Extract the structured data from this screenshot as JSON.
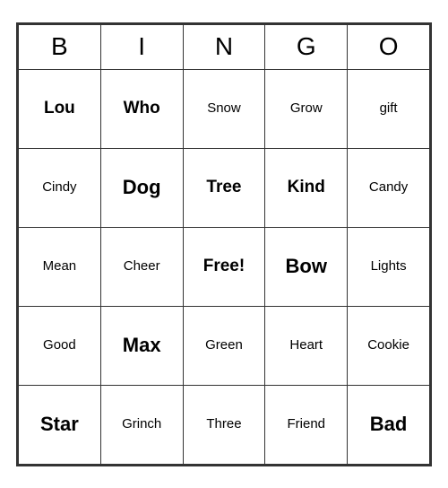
{
  "header": {
    "letters": [
      "B",
      "I",
      "N",
      "G",
      "O"
    ]
  },
  "rows": [
    [
      {
        "text": "Lou",
        "size": "medium"
      },
      {
        "text": "Who",
        "size": "medium"
      },
      {
        "text": "Snow",
        "size": "small"
      },
      {
        "text": "Grow",
        "size": "small"
      },
      {
        "text": "gift",
        "size": "small"
      }
    ],
    [
      {
        "text": "Cindy",
        "size": "small"
      },
      {
        "text": "Dog",
        "size": "large"
      },
      {
        "text": "Tree",
        "size": "medium"
      },
      {
        "text": "Kind",
        "size": "medium"
      },
      {
        "text": "Candy",
        "size": "small"
      }
    ],
    [
      {
        "text": "Mean",
        "size": "small"
      },
      {
        "text": "Cheer",
        "size": "small"
      },
      {
        "text": "Free!",
        "size": "medium"
      },
      {
        "text": "Bow",
        "size": "large"
      },
      {
        "text": "Lights",
        "size": "small"
      }
    ],
    [
      {
        "text": "Good",
        "size": "small"
      },
      {
        "text": "Max",
        "size": "large"
      },
      {
        "text": "Green",
        "size": "small"
      },
      {
        "text": "Heart",
        "size": "small"
      },
      {
        "text": "Cookie",
        "size": "small"
      }
    ],
    [
      {
        "text": "Star",
        "size": "large"
      },
      {
        "text": "Grinch",
        "size": "small"
      },
      {
        "text": "Three",
        "size": "small"
      },
      {
        "text": "Friend",
        "size": "small"
      },
      {
        "text": "Bad",
        "size": "large"
      }
    ]
  ]
}
